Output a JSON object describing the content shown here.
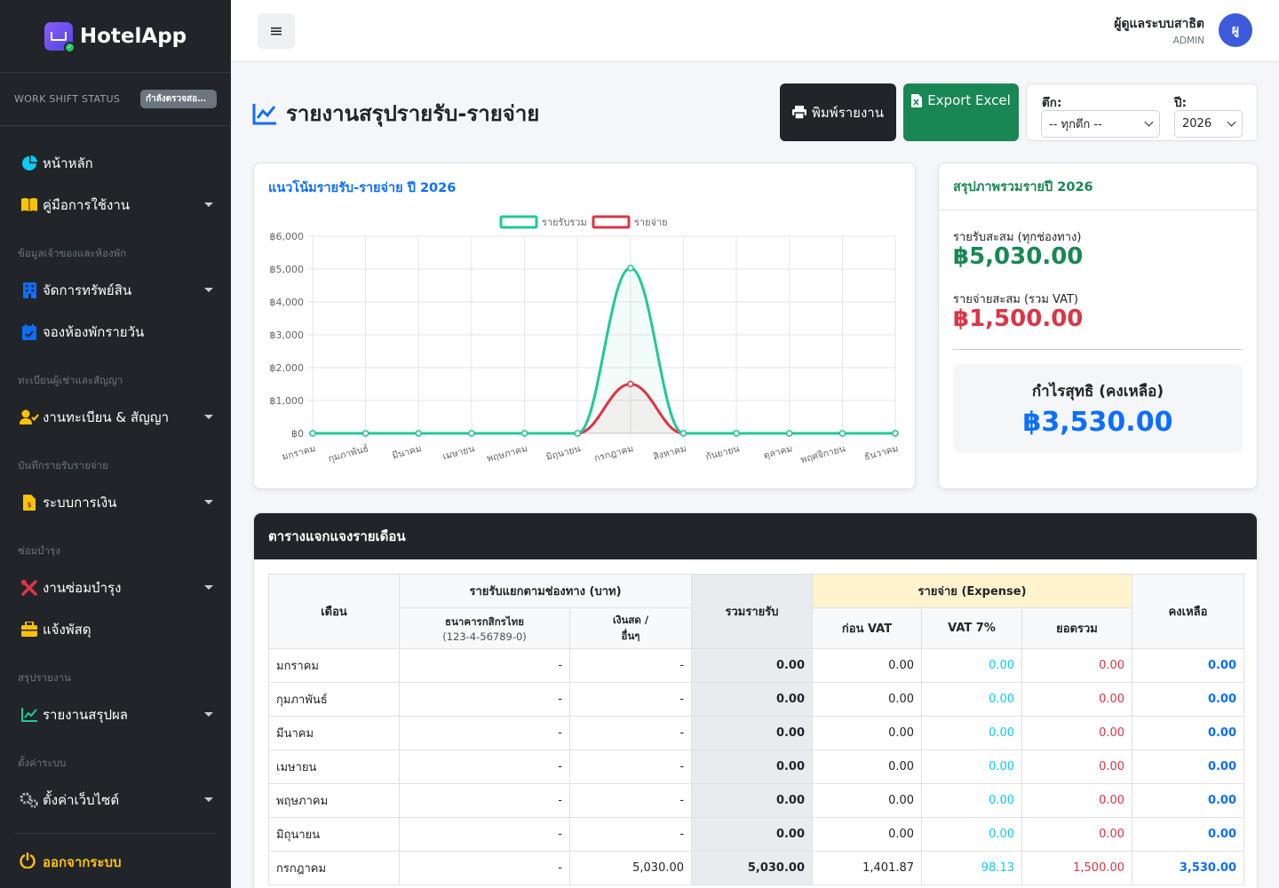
{
  "brand": {
    "name": "HotelApp"
  },
  "shift": {
    "label": "WORK SHIFT STATUS",
    "status": "กำลังตรวจสอบ..."
  },
  "nav": {
    "home": "หน้าหลัก",
    "manual": "คู่มือการใช้งาน",
    "sec_owner": "ข้อมูลเจ้าของและห้องพัก",
    "assets": "จัดการทรัพย์สิน",
    "booking": "จองห้องพักรายวัน",
    "sec_tenant": "ทะเบียนผู้เช่าและสัญญา",
    "tenant": "งานทะเบียน & สัญญา",
    "sec_finance": "บันทึกรายรับรายจ่าย",
    "finance": "ระบบการเงิน",
    "sec_repair": "ซ่อมบำรุง",
    "repair": "งานซ่อมบำรุง",
    "parcel": "แจ้งพัสดุ",
    "sec_report": "สรุปรายงาน",
    "report": "รายงานสรุปผล",
    "sec_settings": "ตั้งค่าระบบ",
    "settings": "ตั้งค่าเว็บไซต์",
    "logout": "ออกจากระบบ"
  },
  "topbar": {
    "user_name": "ผู้ดูแลระบบสาธิต",
    "user_role": "ADMIN",
    "avatar": "ผู"
  },
  "header": {
    "title": "รายงานสรุปรายรับ-รายจ่าย",
    "print_label": "พิมพ์รายงาน",
    "excel_label": "Export Excel",
    "building_label": "ตึก:",
    "building_value": "-- ทุกตึก --",
    "year_label": "ปี:",
    "year_value": "2026"
  },
  "chart_card": {
    "title": "แนวโน้มรายรับ-รายจ่าย ปี 2026"
  },
  "chart_data": {
    "type": "line",
    "categories": [
      "มกราคม",
      "กุมภาพันธ์",
      "มีนาคม",
      "เมษายน",
      "พฤษภาคม",
      "มิถุนายน",
      "กรกฎาคม",
      "สิงหาคม",
      "กันยายน",
      "ตุลาคม",
      "พฤศจิกายน",
      "ธันวาคม"
    ],
    "series": [
      {
        "name": "รายรับรวม",
        "values": [
          0,
          0,
          0,
          0,
          0,
          0,
          5030,
          0,
          0,
          0,
          0,
          0
        ],
        "color": "#20c997"
      },
      {
        "name": "รายจ่าย",
        "values": [
          0,
          0,
          0,
          0,
          0,
          0,
          1500,
          0,
          0,
          0,
          0,
          0
        ],
        "color": "#dc3545"
      }
    ],
    "y_ticks": [
      "฿0",
      "฿1,000",
      "฿2,000",
      "฿3,000",
      "฿4,000",
      "฿5,000",
      "฿6,000"
    ],
    "ylim": [
      0,
      6000
    ],
    "grid": true,
    "legend": "top"
  },
  "summary": {
    "title": "สรุปภาพรวมรายปี 2026",
    "income_label": "รายรับสะสม (ทุกช่องทาง)",
    "income_value": "฿5,030.00",
    "expense_label": "รายจ่ายสะสม (รวม VAT)",
    "expense_value": "฿1,500.00",
    "net_label": "กำไรสุทธิ (คงเหลือ)",
    "net_value": "฿3,530.00"
  },
  "table": {
    "title": "ตารางแจกแจงรายเดือน",
    "h_month": "เดือน",
    "h_income_group": "รายรับแยกตามช่องทาง (บาท)",
    "h_bank": "ธนาคารกสิกรไทย",
    "h_bank_acct": "(123-4-56789-0)",
    "h_cash1": "เงินสด /",
    "h_cash2": "อื่นๆ",
    "h_total_income": "รวมรายรับ",
    "h_expense_group": "รายจ่าย (Expense)",
    "h_pre_vat": "ก่อน VAT",
    "h_vat": "VAT 7%",
    "h_exp_total": "ยอดรวม",
    "h_balance": "คงเหลือ",
    "rows": [
      {
        "month": "มกราคม",
        "bank": "-",
        "cash": "-",
        "total": "0.00",
        "pre_vat": "0.00",
        "vat": "0.00",
        "exp_total": "0.00",
        "balance": "0.00"
      },
      {
        "month": "กุมภาพันธ์",
        "bank": "-",
        "cash": "-",
        "total": "0.00",
        "pre_vat": "0.00",
        "vat": "0.00",
        "exp_total": "0.00",
        "balance": "0.00"
      },
      {
        "month": "มีนาคม",
        "bank": "-",
        "cash": "-",
        "total": "0.00",
        "pre_vat": "0.00",
        "vat": "0.00",
        "exp_total": "0.00",
        "balance": "0.00"
      },
      {
        "month": "เมษายน",
        "bank": "-",
        "cash": "-",
        "total": "0.00",
        "pre_vat": "0.00",
        "vat": "0.00",
        "exp_total": "0.00",
        "balance": "0.00"
      },
      {
        "month": "พฤษภาคม",
        "bank": "-",
        "cash": "-",
        "total": "0.00",
        "pre_vat": "0.00",
        "vat": "0.00",
        "exp_total": "0.00",
        "balance": "0.00"
      },
      {
        "month": "มิถุนายน",
        "bank": "-",
        "cash": "-",
        "total": "0.00",
        "pre_vat": "0.00",
        "vat": "0.00",
        "exp_total": "0.00",
        "balance": "0.00"
      },
      {
        "month": "กรกฎาคม",
        "bank": "-",
        "cash": "5,030.00",
        "total": "5,030.00",
        "pre_vat": "1,401.87",
        "vat": "98.13",
        "exp_total": "1,500.00",
        "balance": "3,530.00"
      }
    ]
  },
  "colors": {
    "sidebar_bg": "#212529",
    "primary": "#0d6efd",
    "success": "#198754",
    "danger": "#dc3545",
    "info": "#0dcaf0",
    "warning": "#ffc107"
  }
}
